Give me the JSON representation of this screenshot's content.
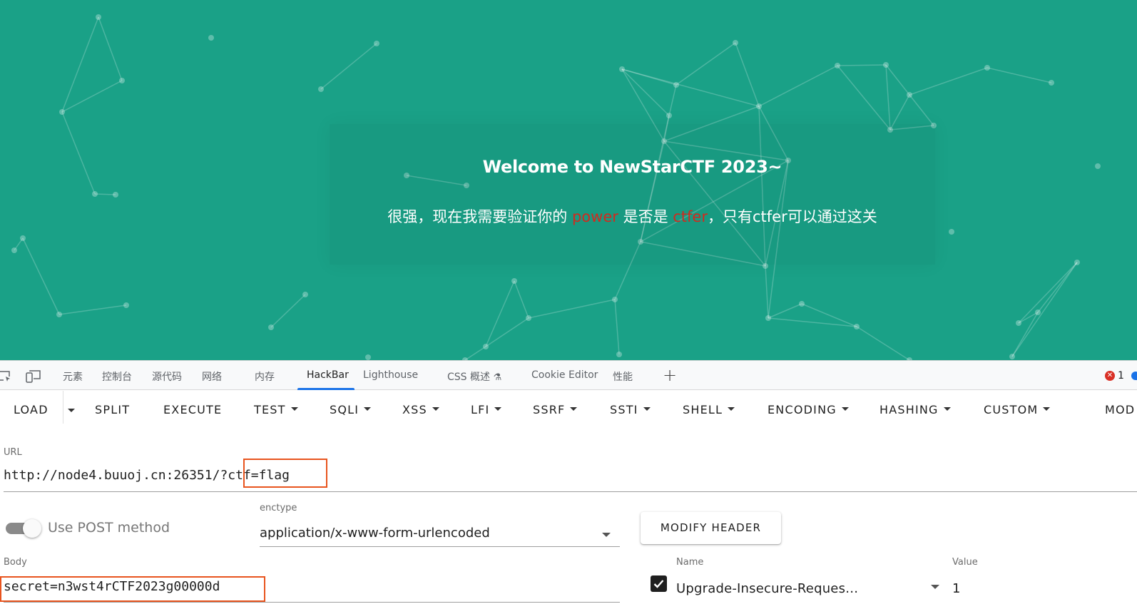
{
  "page": {
    "card_title": "Welcome to NewStarCTF 2023~",
    "message_before": "很强，现在我需要验证你的 ",
    "message_power": "power",
    "message_middle": " 是否是 ",
    "message_ctfer": "ctfer",
    "message_after": "，只有ctfer可以通过这关",
    "colors": {
      "background": "#1aa187",
      "highlight": "#d12a1e"
    }
  },
  "devtools": {
    "icons": [
      "inspect-icon",
      "device-toolbar-icon"
    ],
    "tabs": [
      "元素",
      "控制台",
      "源代码",
      "网络",
      "内存",
      "HackBar",
      "Lighthouse",
      "CSS 概述",
      "Cookie Editor",
      "性能"
    ],
    "active_tab": "HackBar",
    "add_tab": "+",
    "error_count": "1"
  },
  "hackbar": {
    "toolbar": {
      "load": "LOAD",
      "split": "SPLIT",
      "execute": "EXECUTE",
      "test": "TEST",
      "sqli": "SQLI",
      "xss": "XSS",
      "lfi": "LFI",
      "ssrf": "SSRF",
      "ssti": "SSTI",
      "shell": "SHELL",
      "encoding": "ENCODING",
      "hashing": "HASHING",
      "custom": "CUSTOM",
      "mode": "MOD"
    },
    "url": {
      "label": "URL",
      "value_base": "http://node4.buuoj.cn:26351/",
      "value_query": "?ctf=flag"
    },
    "post": {
      "toggle_label": "Use POST method",
      "toggle_on": true,
      "enctype_label": "enctype",
      "enctype_value": "application/x-www-form-urlencoded",
      "modify_header": "MODIFY HEADER"
    },
    "body": {
      "label": "Body",
      "value": "secret=n3wst4rCTF2023g00000d"
    },
    "header": {
      "name_label": "Name",
      "name_value": "Upgrade-Insecure-Reques…",
      "value_label": "Value",
      "value_value": "1",
      "enabled": true
    }
  }
}
